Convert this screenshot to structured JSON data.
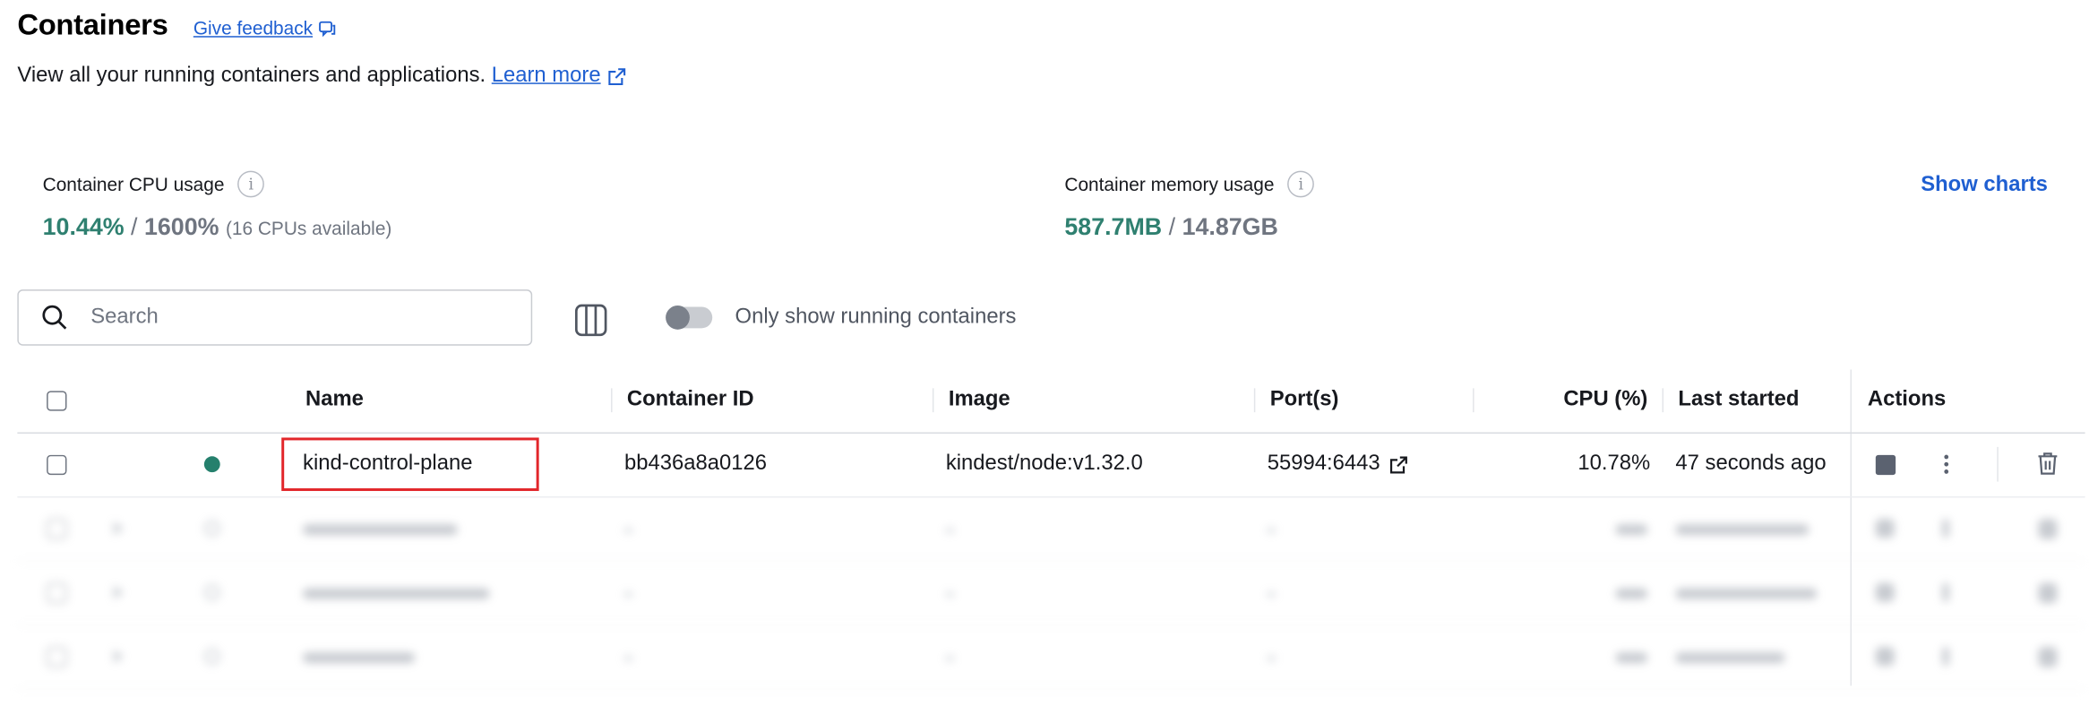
{
  "header": {
    "title": "Containers",
    "feedback_label": "Give feedback",
    "subtitle": "View all your running containers and applications.",
    "learn_more_label": "Learn more"
  },
  "stats": {
    "cpu": {
      "label": "Container CPU usage",
      "used": "10.44%",
      "separator": "/",
      "total": "1600%",
      "note": "(16 CPUs available)"
    },
    "memory": {
      "label": "Container memory usage",
      "used": "587.7MB",
      "separator": "/",
      "total": "14.87GB"
    },
    "show_charts_label": "Show charts"
  },
  "toolbar": {
    "search_placeholder": "Search",
    "toggle_label": "Only show running containers",
    "toggle_on": false
  },
  "table": {
    "columns": {
      "name": "Name",
      "container_id": "Container ID",
      "image": "Image",
      "ports": "Port(s)",
      "cpu": "CPU (%)",
      "last_started": "Last started",
      "actions": "Actions"
    },
    "rows": [
      {
        "name": "kind-control-plane",
        "container_id": "bb436a8a0126",
        "image": "kindest/node:v1.32.0",
        "ports": "55994:6443",
        "cpu": "10.78%",
        "last_started": "47 seconds ago",
        "status": "running"
      }
    ]
  },
  "colors": {
    "accent": "#1f5fd1",
    "running": "#25806d",
    "highlight": "#e2262a"
  },
  "icons": {
    "feedback": "chat-bubble-icon",
    "external": "external-link-icon",
    "info": "info-icon",
    "search": "search-icon",
    "columns": "columns-icon",
    "stop": "stop-icon",
    "more": "more-vertical-icon",
    "delete": "trash-icon"
  }
}
